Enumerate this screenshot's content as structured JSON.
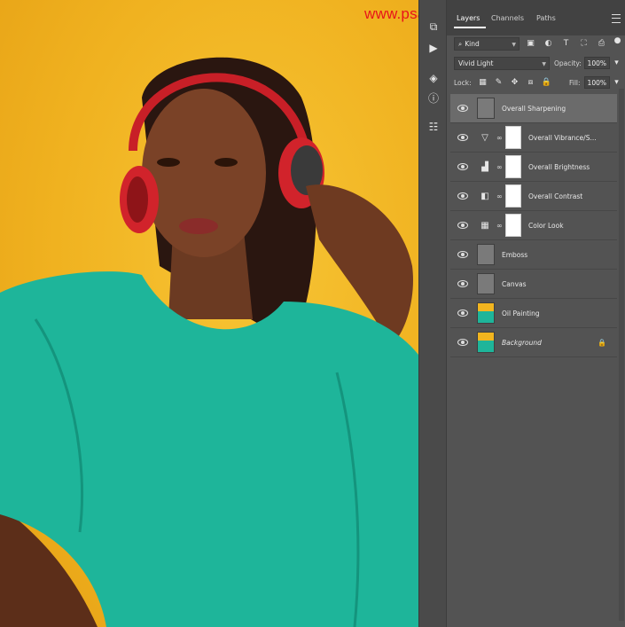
{
  "watermark": "www.psahz.com/chai.com",
  "canvas": {
    "description_icon": "photo-canvas"
  },
  "toolstrip": {
    "tools": [
      "history-icon",
      "play-icon",
      "3d-icon",
      "info-icon",
      "properties-icon"
    ]
  },
  "tabs": [
    {
      "label": "Layers",
      "active": true
    },
    {
      "label": "Channels",
      "active": false
    },
    {
      "label": "Paths",
      "active": false
    }
  ],
  "filter": {
    "kind_label": "Kind"
  },
  "blend": {
    "mode": "Vivid Light",
    "opacity_label": "Opacity:",
    "opacity_value": "100%",
    "lock_label": "Lock:",
    "fill_label": "Fill:",
    "fill_value": "100%"
  },
  "layers": [
    {
      "name": "Overall Sharpening",
      "type": "pixel",
      "selected": true
    },
    {
      "name": "Overall Vibrance/S...",
      "type": "vibrance",
      "icon": "triangle-icon"
    },
    {
      "name": "Overall Brightness",
      "type": "levels",
      "icon": "histogram-icon"
    },
    {
      "name": "Overall Contrast",
      "type": "curves",
      "icon": "gradient-icon"
    },
    {
      "name": "Color Look",
      "type": "lookup",
      "icon": "grid-icon"
    },
    {
      "name": "Emboss",
      "type": "pixel"
    },
    {
      "name": "Canvas",
      "type": "pixel"
    },
    {
      "name": "Oil Painting",
      "type": "photo"
    },
    {
      "name": "Background",
      "type": "photo",
      "locked": true
    }
  ],
  "colors": {
    "panel_bg": "#535353",
    "accent_yellow": "#f2b51f",
    "dress_teal": "#1eb59a",
    "watermark_red": "#e8141a"
  }
}
